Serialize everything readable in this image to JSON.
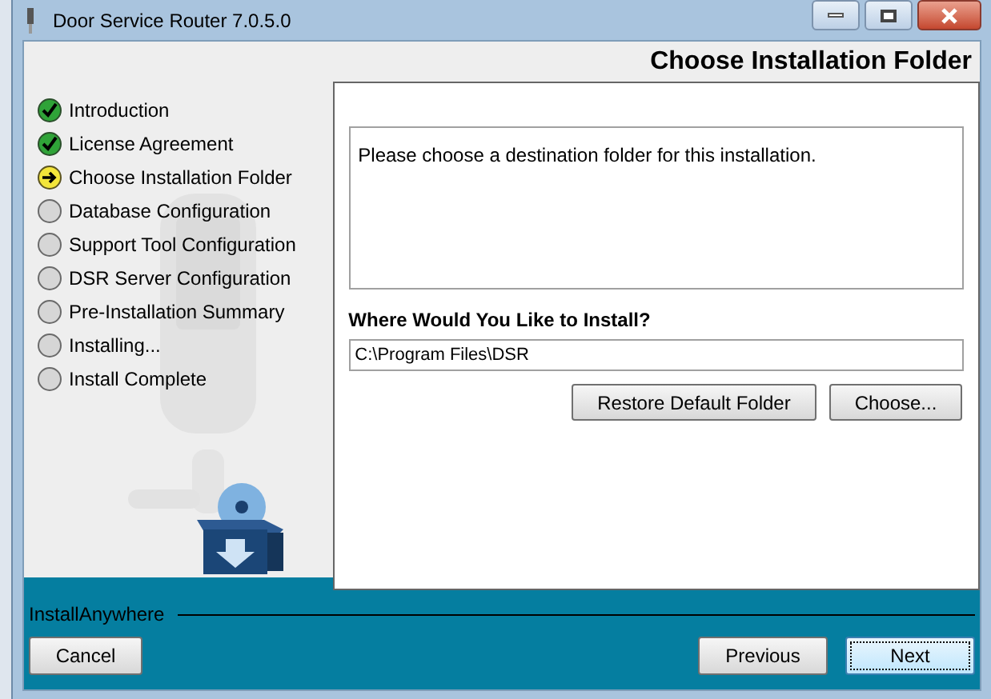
{
  "window": {
    "title": "Door Service Router 7.0.5.0"
  },
  "header": {
    "title": "Choose Installation Folder"
  },
  "steps": [
    {
      "label": "Introduction",
      "completed": true,
      "current": false
    },
    {
      "label": "License Agreement",
      "completed": true,
      "current": false
    },
    {
      "label": "Choose Installation Folder",
      "completed": false,
      "current": true
    },
    {
      "label": "Database Configuration",
      "completed": false,
      "current": false
    },
    {
      "label": "Support Tool Configuration",
      "completed": false,
      "current": false
    },
    {
      "label": "DSR Server Configuration",
      "completed": false,
      "current": false
    },
    {
      "label": "Pre-Installation Summary",
      "completed": false,
      "current": false
    },
    {
      "label": "Installing...",
      "completed": false,
      "current": false
    },
    {
      "label": "Install Complete",
      "completed": false,
      "current": false
    }
  ],
  "content": {
    "description": "Please choose a destination folder for this installation.",
    "folder_label": "Where Would You Like to Install?",
    "folder_value": "C:\\Program Files\\DSR",
    "buttons": [
      "Restore Default Folder",
      "Choose..."
    ]
  },
  "footer": {
    "brand": "InstallAnywhere",
    "cancel": {
      "label": "Cancel",
      "focused": false
    },
    "previous": {
      "label": "Previous",
      "focused": false
    },
    "next": {
      "label": "Next",
      "focused": true
    }
  }
}
